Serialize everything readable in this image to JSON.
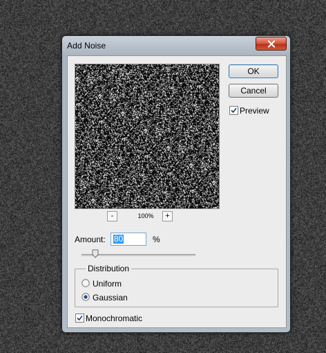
{
  "dialog": {
    "title": "Add Noise",
    "close_icon": "close-icon"
  },
  "preview": {
    "zoom_out_label": "-",
    "zoom_in_label": "+",
    "zoom_level": "100%"
  },
  "buttons": {
    "ok_label": "OK",
    "cancel_label": "Cancel"
  },
  "preview_checkbox": {
    "label": "Preview",
    "checked": true
  },
  "amount": {
    "label": "Amount:",
    "value": "80",
    "unit": "%"
  },
  "distribution": {
    "title": "Distribution",
    "options": [
      {
        "label": "Uniform",
        "selected": false
      },
      {
        "label": "Gaussian",
        "selected": true
      }
    ]
  },
  "monochromatic": {
    "label": "Monochromatic",
    "checked": true
  },
  "colors": {
    "close_button": "#c9482f",
    "selection": "#3399ff",
    "default_button_border": "#3c7fb1"
  }
}
